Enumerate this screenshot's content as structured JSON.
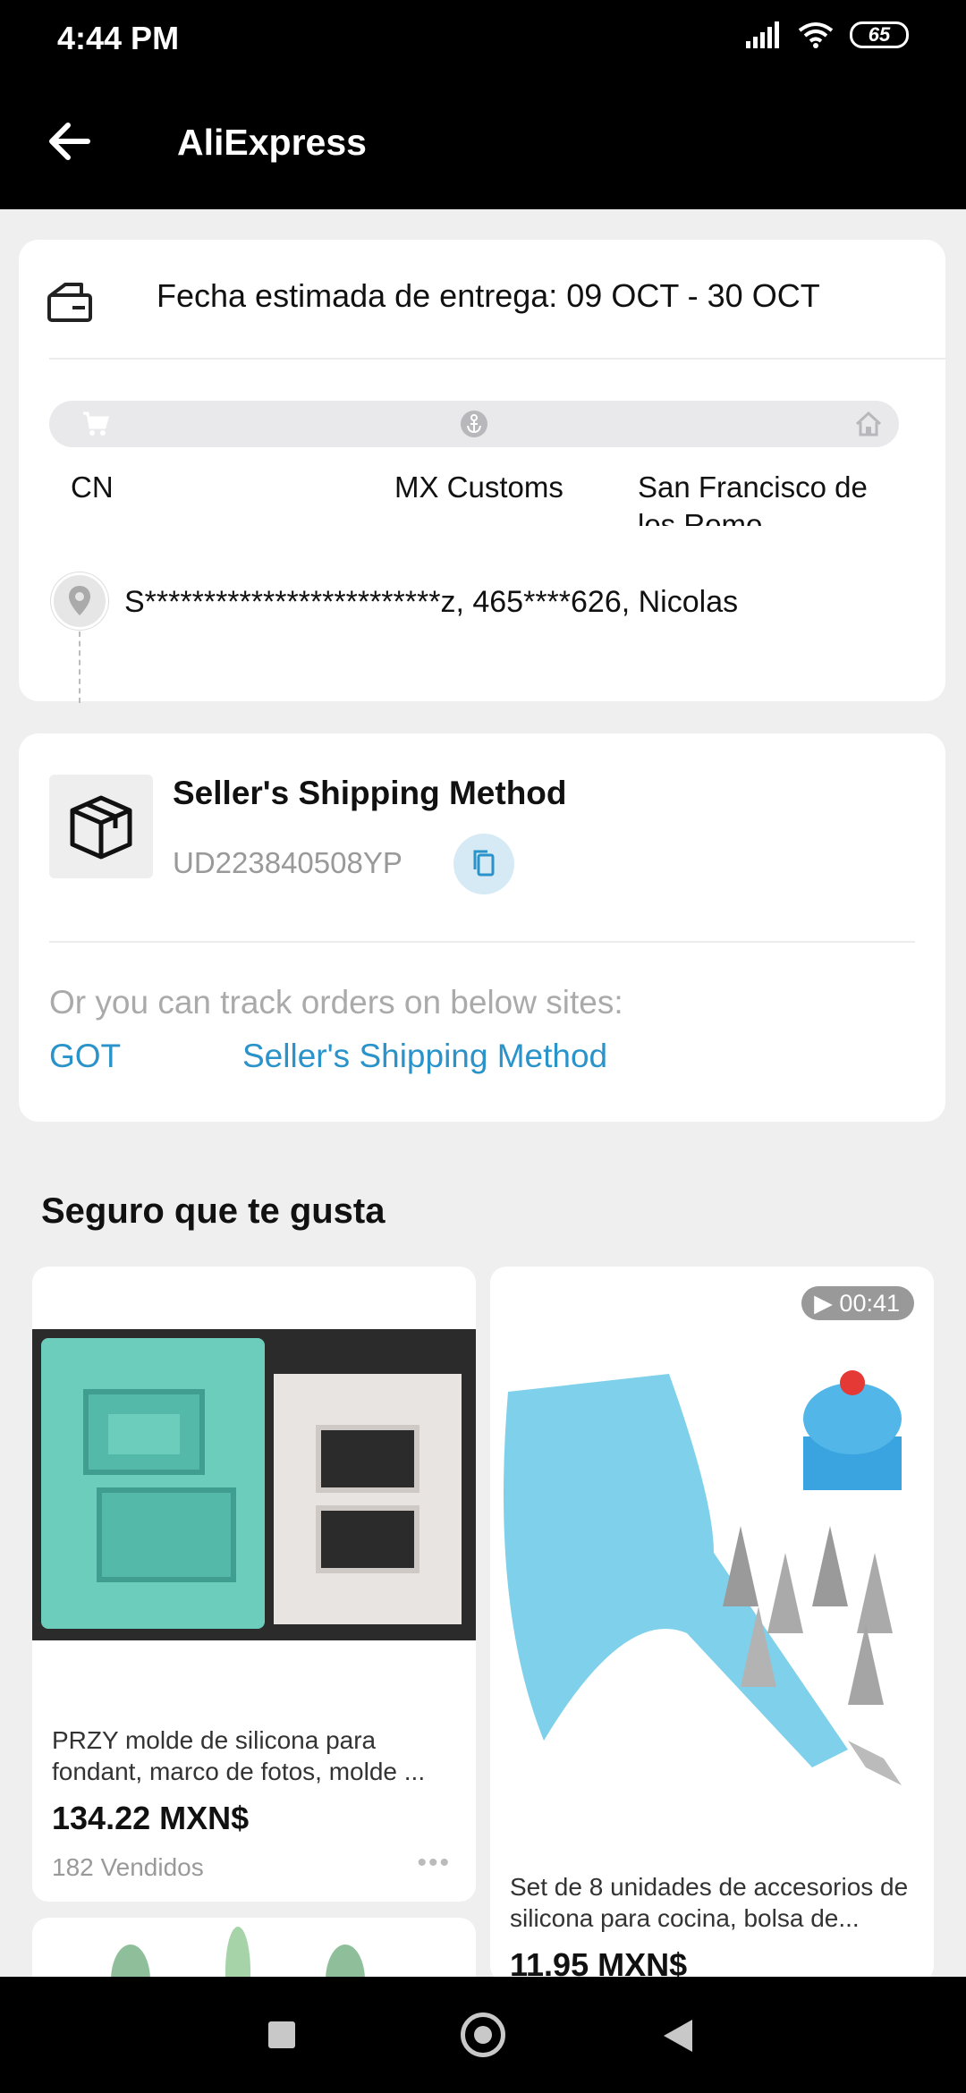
{
  "status_bar": {
    "time": "4:44 PM",
    "battery": "65"
  },
  "app_bar": {
    "title": "AliExpress"
  },
  "delivery": {
    "estimate": "Fecha estimada de entrega: 09 OCT - 30 OCT",
    "stops": [
      "CN",
      "MX Customs",
      "San Francisco de los Romo"
    ],
    "address": "S*************************z,  465****626,  Nicolas"
  },
  "shipping": {
    "method": "Seller's Shipping Method",
    "tracking_number": "UD223840508YP",
    "hint": "Or you can track orders on below sites:",
    "links": [
      "GOT",
      "Seller's Shipping Method"
    ]
  },
  "recommendations": {
    "title": "Seguro que te gusta",
    "products": [
      {
        "name": "PRZY molde de silicona para fondant, marco de fotos, molde ...",
        "price": "134.22 MXN$",
        "sold": "182 Vendidos"
      },
      {
        "name": "Set de 8 unidades de accesorios de silicona para cocina, bolsa de...",
        "price": "11.95 MXN$",
        "video_duration": "00:41"
      }
    ]
  }
}
